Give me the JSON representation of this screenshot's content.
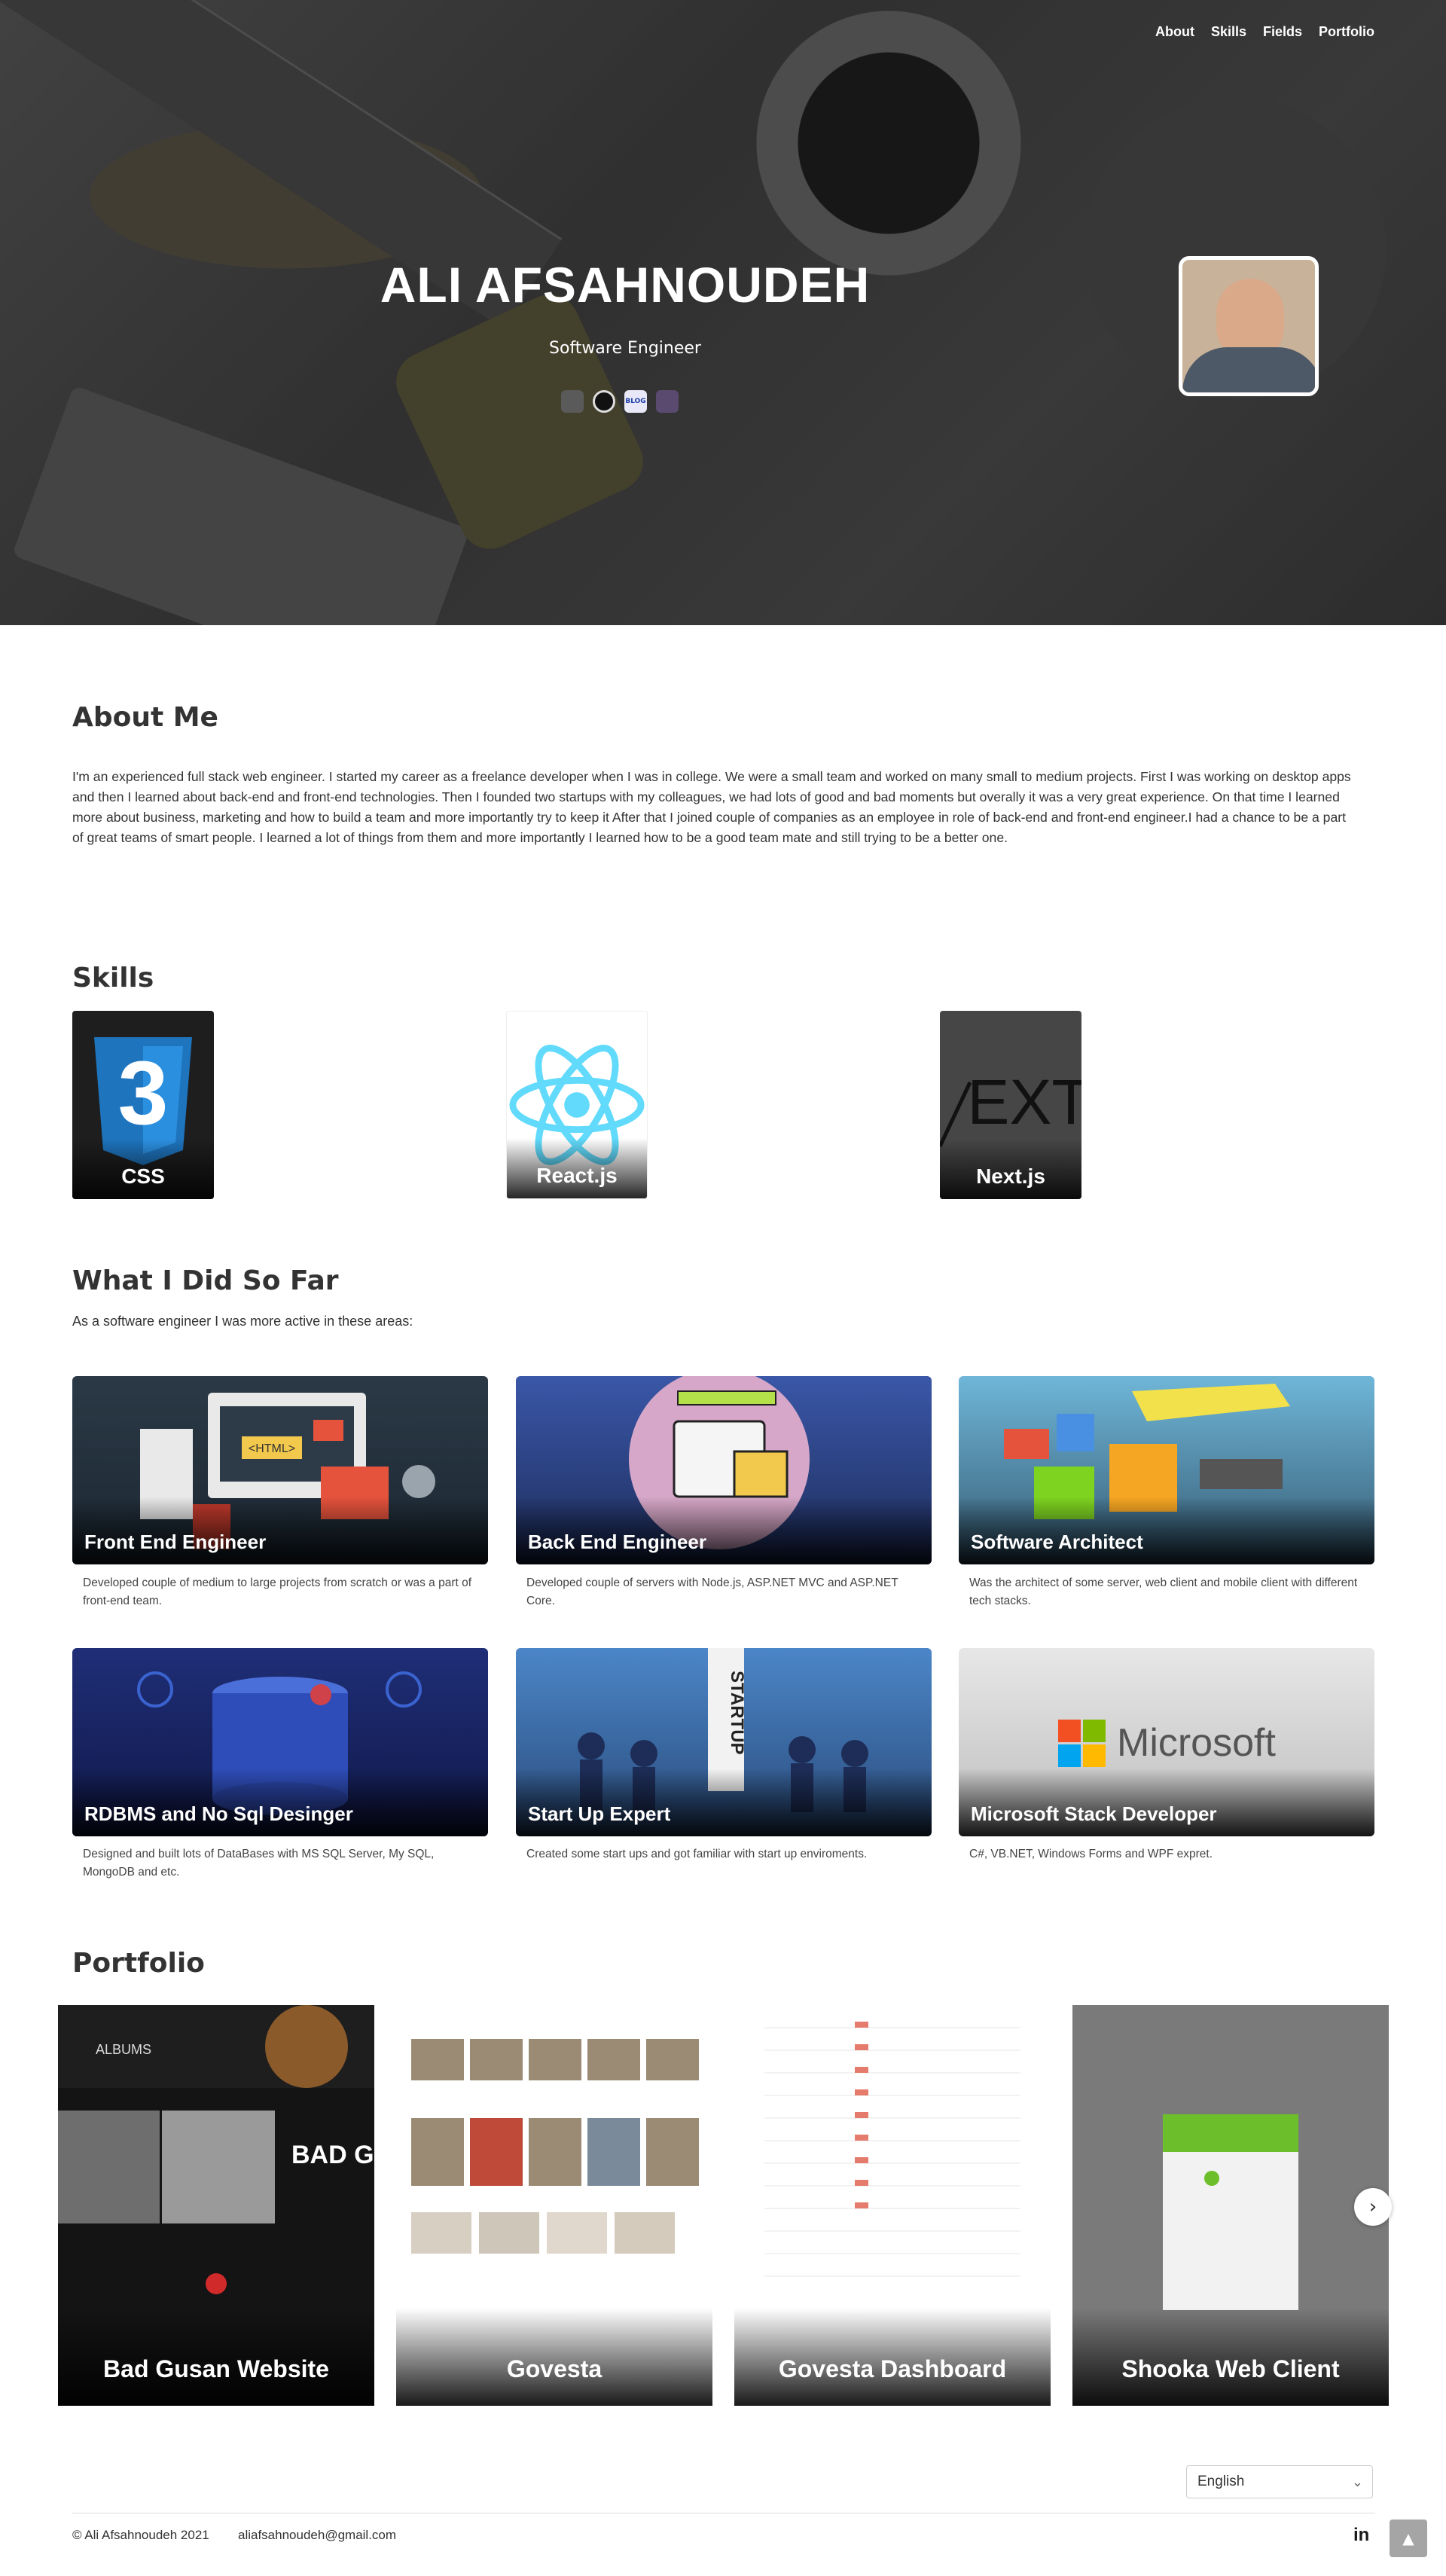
{
  "nav": {
    "items": [
      "About",
      "Skills",
      "Fields",
      "Portfolio"
    ]
  },
  "hero": {
    "name": "ALI AFSAHNOUDEH",
    "role": "Software Engineer",
    "blog_badge": "BLOG",
    "icons": [
      "linkedin-icon",
      "github-icon",
      "blog-icon",
      "stackoverflow-icon"
    ]
  },
  "about": {
    "title": "About Me",
    "text": "I'm an experienced full stack web engineer. I started my career as a freelance developer when I was in college. We were a small team and worked on many small to medium projects. First I was working on desktop apps and then I learned about back-end and front-end technologies. Then I founded two startups with my colleagues, we had lots of good and bad moments but overally it was a very great experience. On that time I learned more about business, marketing and how to build a team and more importantly try to keep it After that I joined couple of companies as an employee in role of back-end and front-end engineer.I had a chance to be a part of great teams of smart people. I learned a lot of things from them and more importantly I learned how to be a good team mate and still trying to be a better one."
  },
  "skills": {
    "title": "Skills",
    "items": [
      {
        "name": "CSS",
        "logo_text": "3"
      },
      {
        "name": "React.js"
      },
      {
        "name": "Next.js",
        "logo_text": "EXT"
      }
    ]
  },
  "fields": {
    "title": "What I Did So Far",
    "intro": "As a software engineer I was more active in these areas:",
    "cards": [
      {
        "title": "Front End Engineer",
        "desc": "Developed couple of medium to large projects from scratch or was a part of front-end team.",
        "art_text": "<HTML>"
      },
      {
        "title": "Back End Engineer",
        "desc": "Developed couple of servers with Node.js, ASP.NET MVC and ASP.NET Core."
      },
      {
        "title": "Software Architect",
        "desc": "Was the architect of some server, web client and mobile client with different tech stacks."
      },
      {
        "title": "RDBMS and No Sql Desinger",
        "desc": "Designed and built lots of DataBases with MS SQL Server, My SQL, MongoDB and etc."
      },
      {
        "title": "Start Up Expert",
        "desc": "Created some start ups and got familiar with start up enviroments.",
        "art_text": "STARTUP"
      },
      {
        "title": "Microsoft Stack Developer",
        "desc": "C#, VB.NET, Windows Forms and WPF expret.",
        "art_text": "Microsoft"
      }
    ]
  },
  "portfolio": {
    "title": "Portfolio",
    "items": [
      {
        "title": "Bad Gusan Website",
        "art_albums": "ALBUMS",
        "art_badge": "BAD GUSAN"
      },
      {
        "title": "Govesta"
      },
      {
        "title": "Govesta Dashboard"
      },
      {
        "title": "Shooka Web Client"
      }
    ],
    "next_icon": "chevron-right-icon"
  },
  "footer": {
    "language": "English",
    "copyright": "© Ali Afsahnoudeh 2021",
    "email": "aliafsahnoudeh@gmail.com",
    "linkedin": "in",
    "to_top_icon": "arrow-up-icon"
  },
  "colors": {
    "accent_green": "#6cbf2a",
    "react_blue": "#61dafb",
    "css_blue": "#1e74bd"
  }
}
